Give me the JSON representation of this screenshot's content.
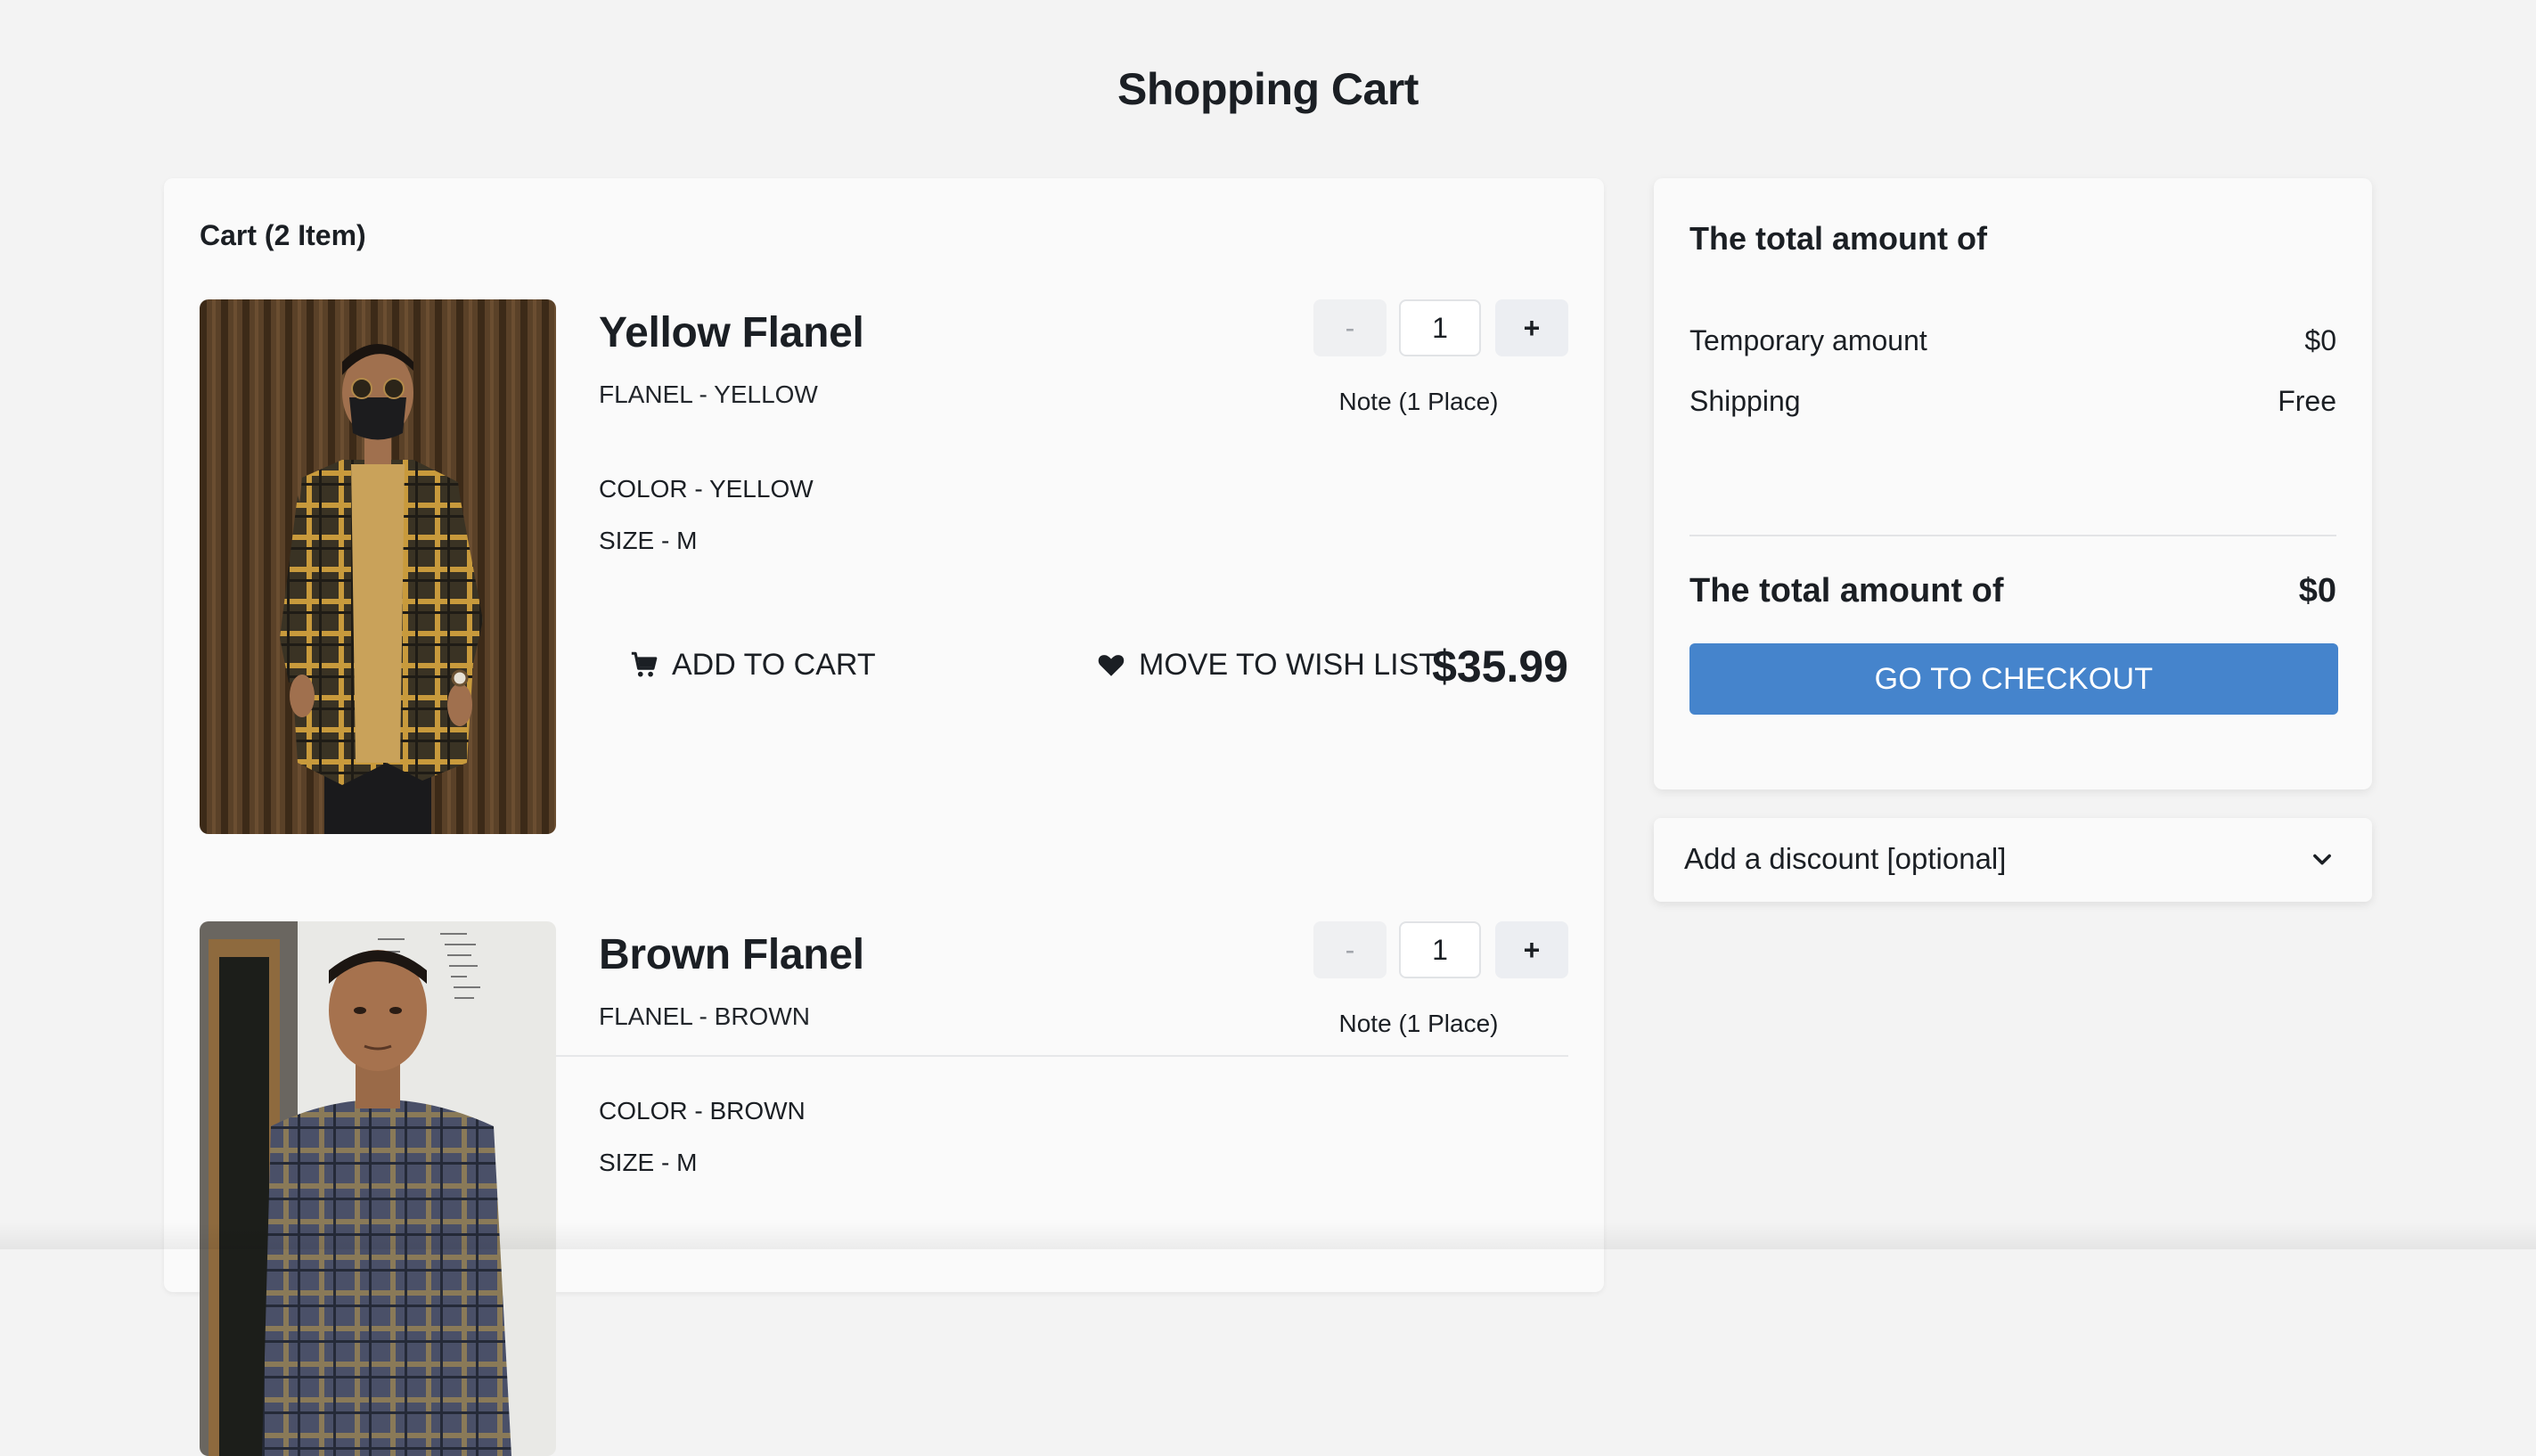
{
  "page": {
    "title": "Shopping Cart"
  },
  "cart": {
    "heading": "Cart (2 Item)",
    "items": [
      {
        "name": "Yellow Flanel",
        "subtitle": "FLANEL - YELLOW",
        "color": "COLOR - YELLOW",
        "size": "SIZE - M",
        "quantity": "1",
        "minus_label": "-",
        "plus_label": "+",
        "note": "Note (1 Place)",
        "add_to_cart_label": "ADD TO CART",
        "wishlist_label": "MOVE TO WISH LIST",
        "price": "$35.99",
        "image_icon": "product-photo-yellow-flannel"
      },
      {
        "name": "Brown Flanel",
        "subtitle": "FLANEL - BROWN",
        "color": "COLOR - BROWN",
        "size": "SIZE - M",
        "quantity": "1",
        "minus_label": "-",
        "plus_label": "+",
        "note": "Note (1 Place)",
        "image_icon": "product-photo-brown-flannel"
      }
    ]
  },
  "summary": {
    "heading": "The total amount of",
    "temporary_label": "Temporary amount",
    "temporary_value": "$0",
    "shipping_label": "Shipping",
    "shipping_value": "Free",
    "total_label": "The total amount of",
    "total_value": "$0",
    "checkout_label": "GO TO CHECKOUT"
  },
  "discount": {
    "label": "Add a discount [optional]",
    "icon": "chevron-down-icon"
  },
  "icons": {
    "cart": "cart-icon",
    "heart": "heart-icon"
  },
  "colors": {
    "background": "#f3f3f3",
    "panel": "#fafafa",
    "checkout_button": "#4584cc",
    "text": "#1b1f24"
  }
}
